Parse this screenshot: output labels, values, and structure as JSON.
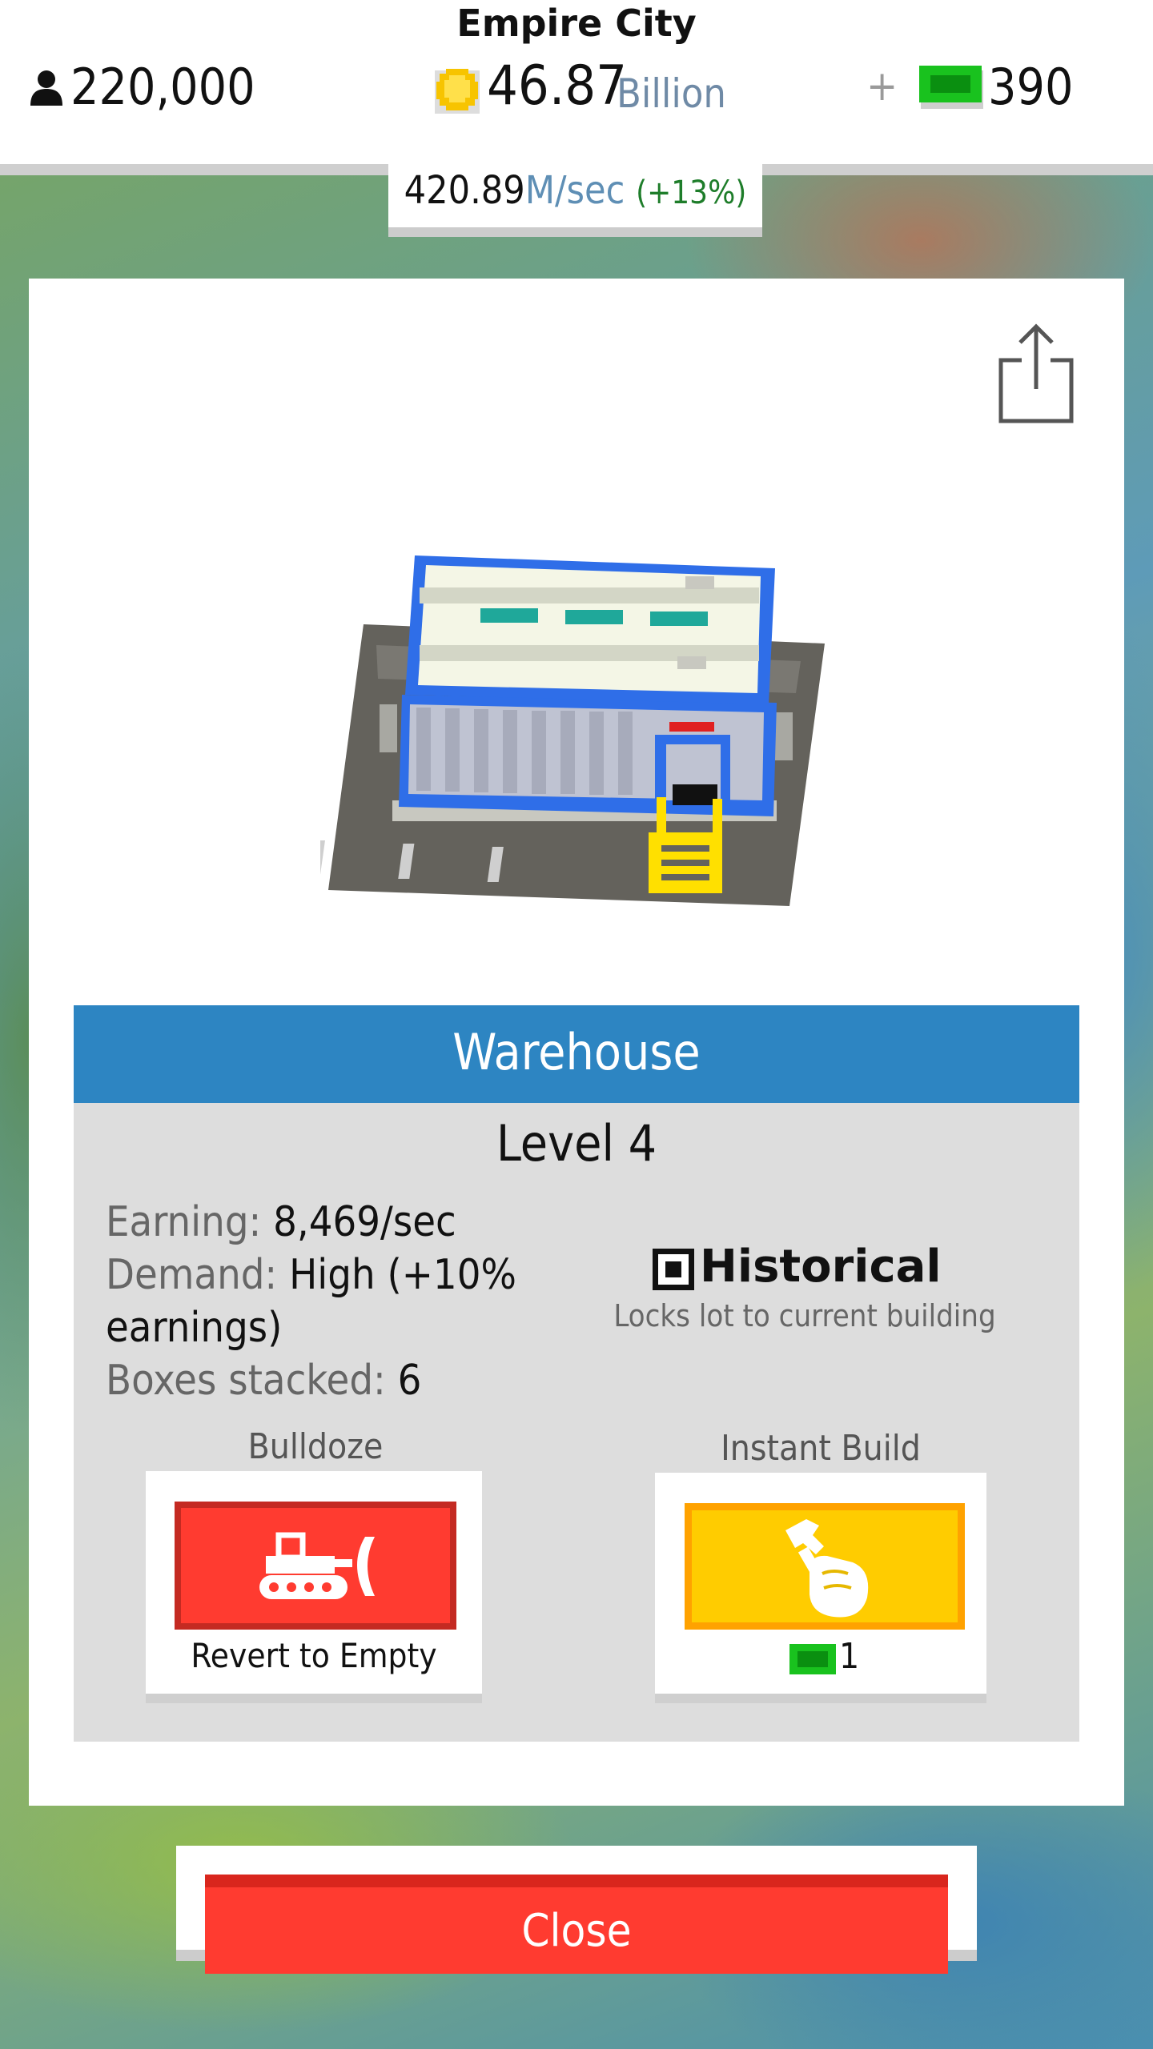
{
  "header": {
    "city_name": "Empire City",
    "population": "220,000",
    "cash_value": "46.87",
    "cash_unit": "Billion",
    "plus_symbol": "+",
    "bux_value": "390",
    "icons": {
      "population": "person-icon",
      "cash": "gold-coin-icon",
      "bux": "green-bill-icon"
    }
  },
  "income": {
    "value": "420.89",
    "unit": "M/sec",
    "bonus": "(+13%)"
  },
  "building": {
    "name": "Warehouse",
    "level": "Level 4",
    "stats": {
      "earning_label": "Earning: ",
      "earning_value": "8,469/sec",
      "demand_label": "Demand: ",
      "demand_value": "High (+10% earnings)",
      "boxes_label": "Boxes stacked: ",
      "boxes_value": "6"
    },
    "historical": {
      "label": "Historical",
      "description": "Locks lot to current building",
      "checked": true
    }
  },
  "actions": {
    "bulldoze": {
      "title": "Bulldoze",
      "caption": "Revert to Empty",
      "icon": "bulldozer-icon"
    },
    "instant_build": {
      "title": "Instant Build",
      "cost": "1",
      "icon": "hammer-hand-icon"
    }
  },
  "close_label": "Close",
  "colors": {
    "title_bar": "#2d85c2",
    "close_red": "#ff3b30",
    "instant_yellow": "#ffcc00",
    "bux_green": "#19c21e",
    "coin_gold": "#f7c400"
  }
}
